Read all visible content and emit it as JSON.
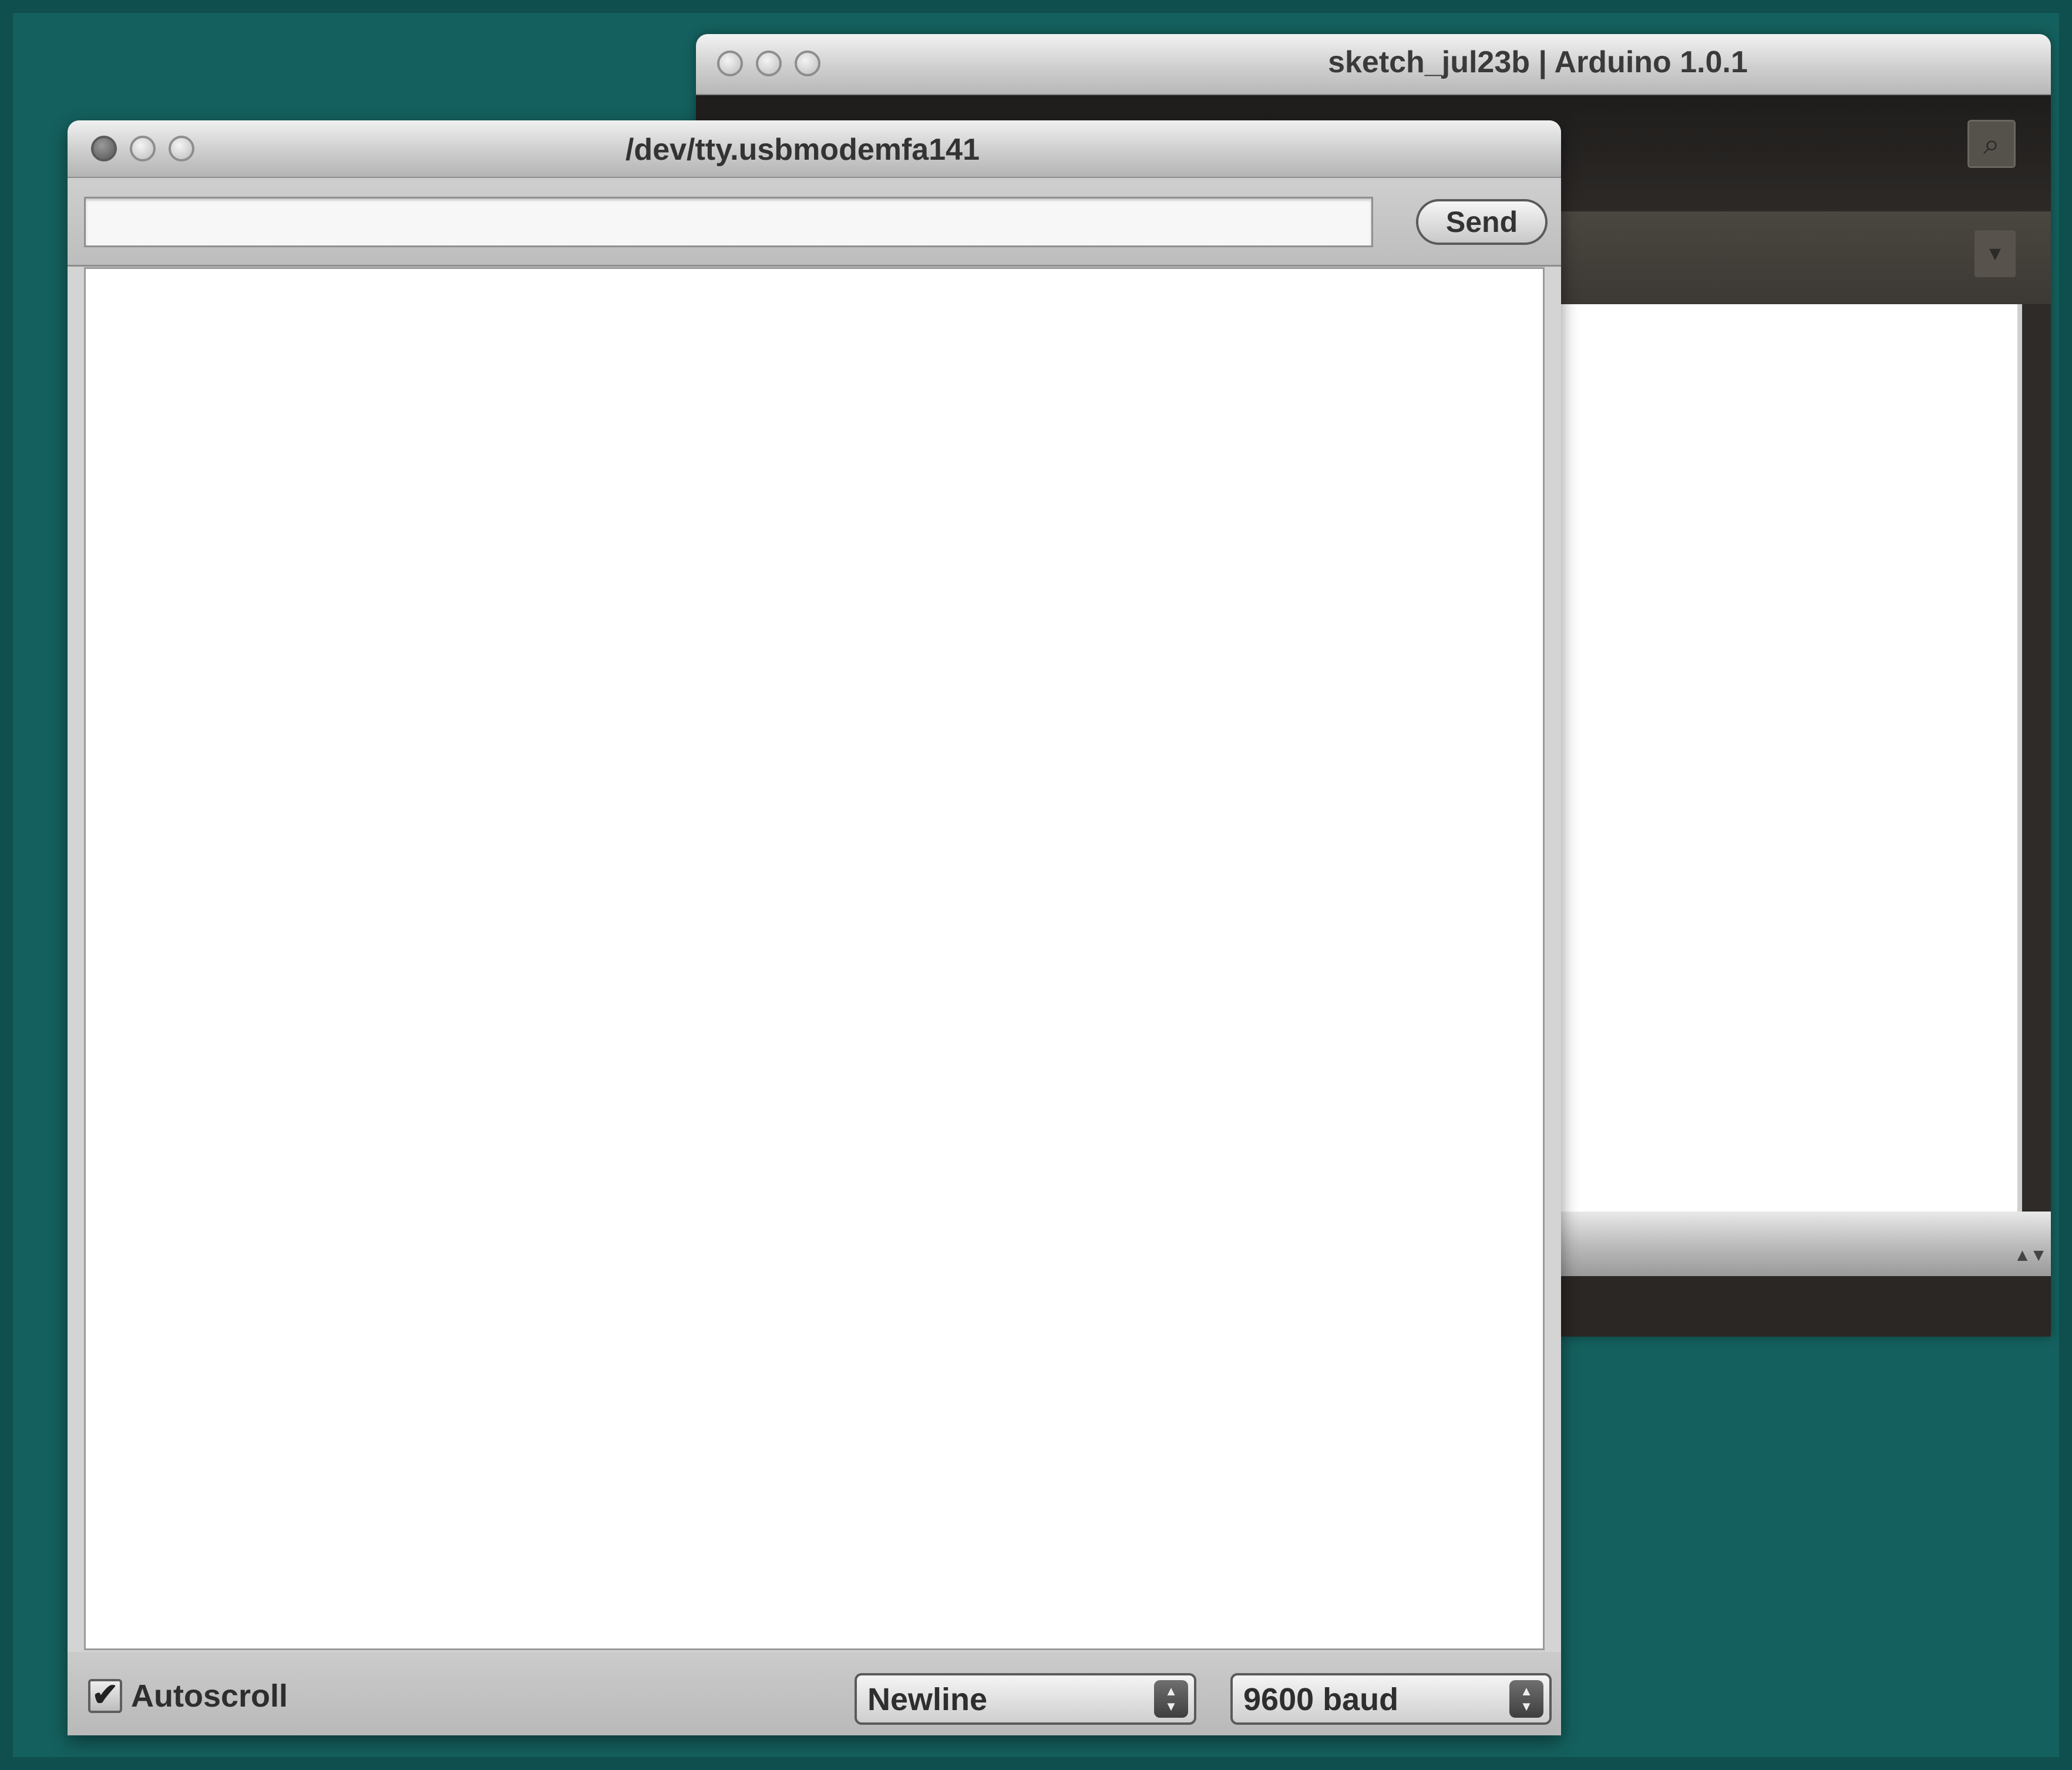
{
  "ide_window": {
    "title": "sketch_jul23b | Arduino 1.0.1"
  },
  "serial_monitor": {
    "title": "/dev/tty.usbmodemfa141",
    "send_input": {
      "value": "",
      "placeholder": ""
    },
    "send_label": "Send",
    "output_text": "",
    "autoscroll": {
      "label": "Autoscroll",
      "checked": true,
      "check_glyph": "✔"
    },
    "line_ending": {
      "selected": "Newline"
    },
    "baud_rate": {
      "selected": "9600 baud"
    }
  },
  "icons": {
    "serial_monitor": "magnifier-icon",
    "tab_menu": "chevron-down-icon",
    "stepper": "up-down-arrows-icon",
    "window_controls": [
      "close-icon",
      "minimize-icon",
      "zoom-icon"
    ]
  },
  "colors": {
    "desktop": "#14605e",
    "ide_toolbar": "#2c2927",
    "window_chrome": "#c8c8c8"
  }
}
